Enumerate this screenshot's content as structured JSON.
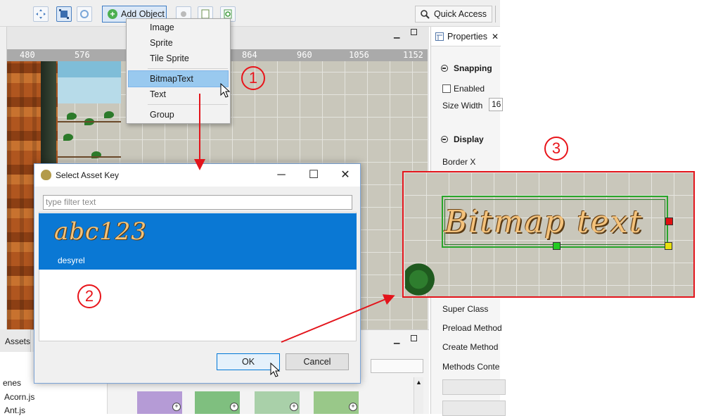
{
  "toolbar": {
    "add_object_label": "Add Object",
    "quick_access_label": "Quick Access"
  },
  "ruler": {
    "ticks": [
      "480",
      "576",
      "864",
      "960",
      "1056",
      "1152"
    ]
  },
  "add_object_menu": {
    "items": [
      {
        "label": "Image"
      },
      {
        "label": "Sprite"
      },
      {
        "label": "Tile Sprite"
      },
      {
        "label": "BitmapText",
        "selected": true
      },
      {
        "label": "Text"
      },
      {
        "label": "Group"
      }
    ]
  },
  "properties": {
    "tab_title": "Properties",
    "snapping": {
      "title": "Snapping",
      "enabled_label": "Enabled",
      "size_width_label": "Size Width",
      "size_width_value": "16"
    },
    "display": {
      "title": "Display",
      "border_x_label": "Border X"
    },
    "more": [
      "Super Class",
      "Preload Method",
      "Create Method",
      "Methods Conte"
    ]
  },
  "bottom": {
    "assets_tab": "Assets",
    "files": [
      "enes",
      "Acorn.js",
      "Ant.js"
    ]
  },
  "dialog": {
    "title": "Select Asset Key",
    "filter_placeholder": "type filter text",
    "asset": {
      "preview_text": "abc123",
      "key": "desyrel"
    },
    "ok_label": "OK",
    "cancel_label": "Cancel"
  },
  "annotations": {
    "step1": "1",
    "step2": "2",
    "step3": "3",
    "bitmap_preview_text": "Bitmap text"
  },
  "colors": {
    "annotation_red": "#e3141b",
    "selection_blue": "#0a78d4",
    "menu_highlight": "#99c9ef",
    "handle_green": "#22cc22",
    "handle_red": "#e01010",
    "handle_yellow": "#e8e010"
  }
}
